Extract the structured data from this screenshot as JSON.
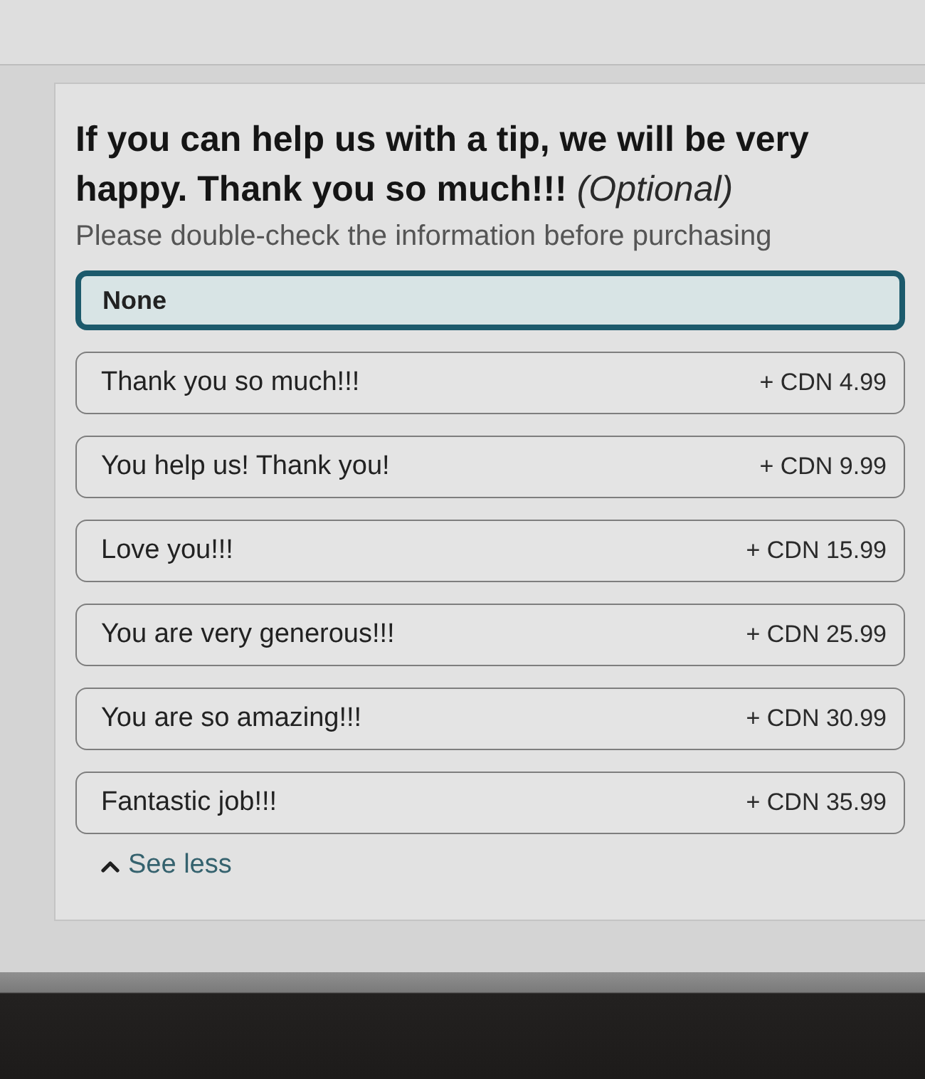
{
  "tip_section": {
    "title": "If you can help us with a tip, we will be very happy. Thank you so much!!! *(Optional)*",
    "subtitle": "Please double-check the information before purchasing",
    "options": [
      {
        "label": "None",
        "selected": true
      },
      {
        "label": "Thank you so much!!!",
        "price": "+ CDN 4.99",
        "selected": false
      },
      {
        "label": "You help us! Thank you!",
        "price": "+ CDN 9.99",
        "selected": false
      },
      {
        "label": "Love you!!!",
        "price": "+ CDN 15.99",
        "selected": false
      },
      {
        "label": "You are very generous!!!",
        "price": "+ CDN 25.99",
        "selected": false
      },
      {
        "label": "You are so amazing!!!",
        "price": "+ CDN 30.99",
        "selected": false
      },
      {
        "label": "Fantastic job!!!",
        "price": "+ CDN 35.99",
        "selected": false
      }
    ],
    "toggle": {
      "label": "See less",
      "expanded": true
    }
  }
}
